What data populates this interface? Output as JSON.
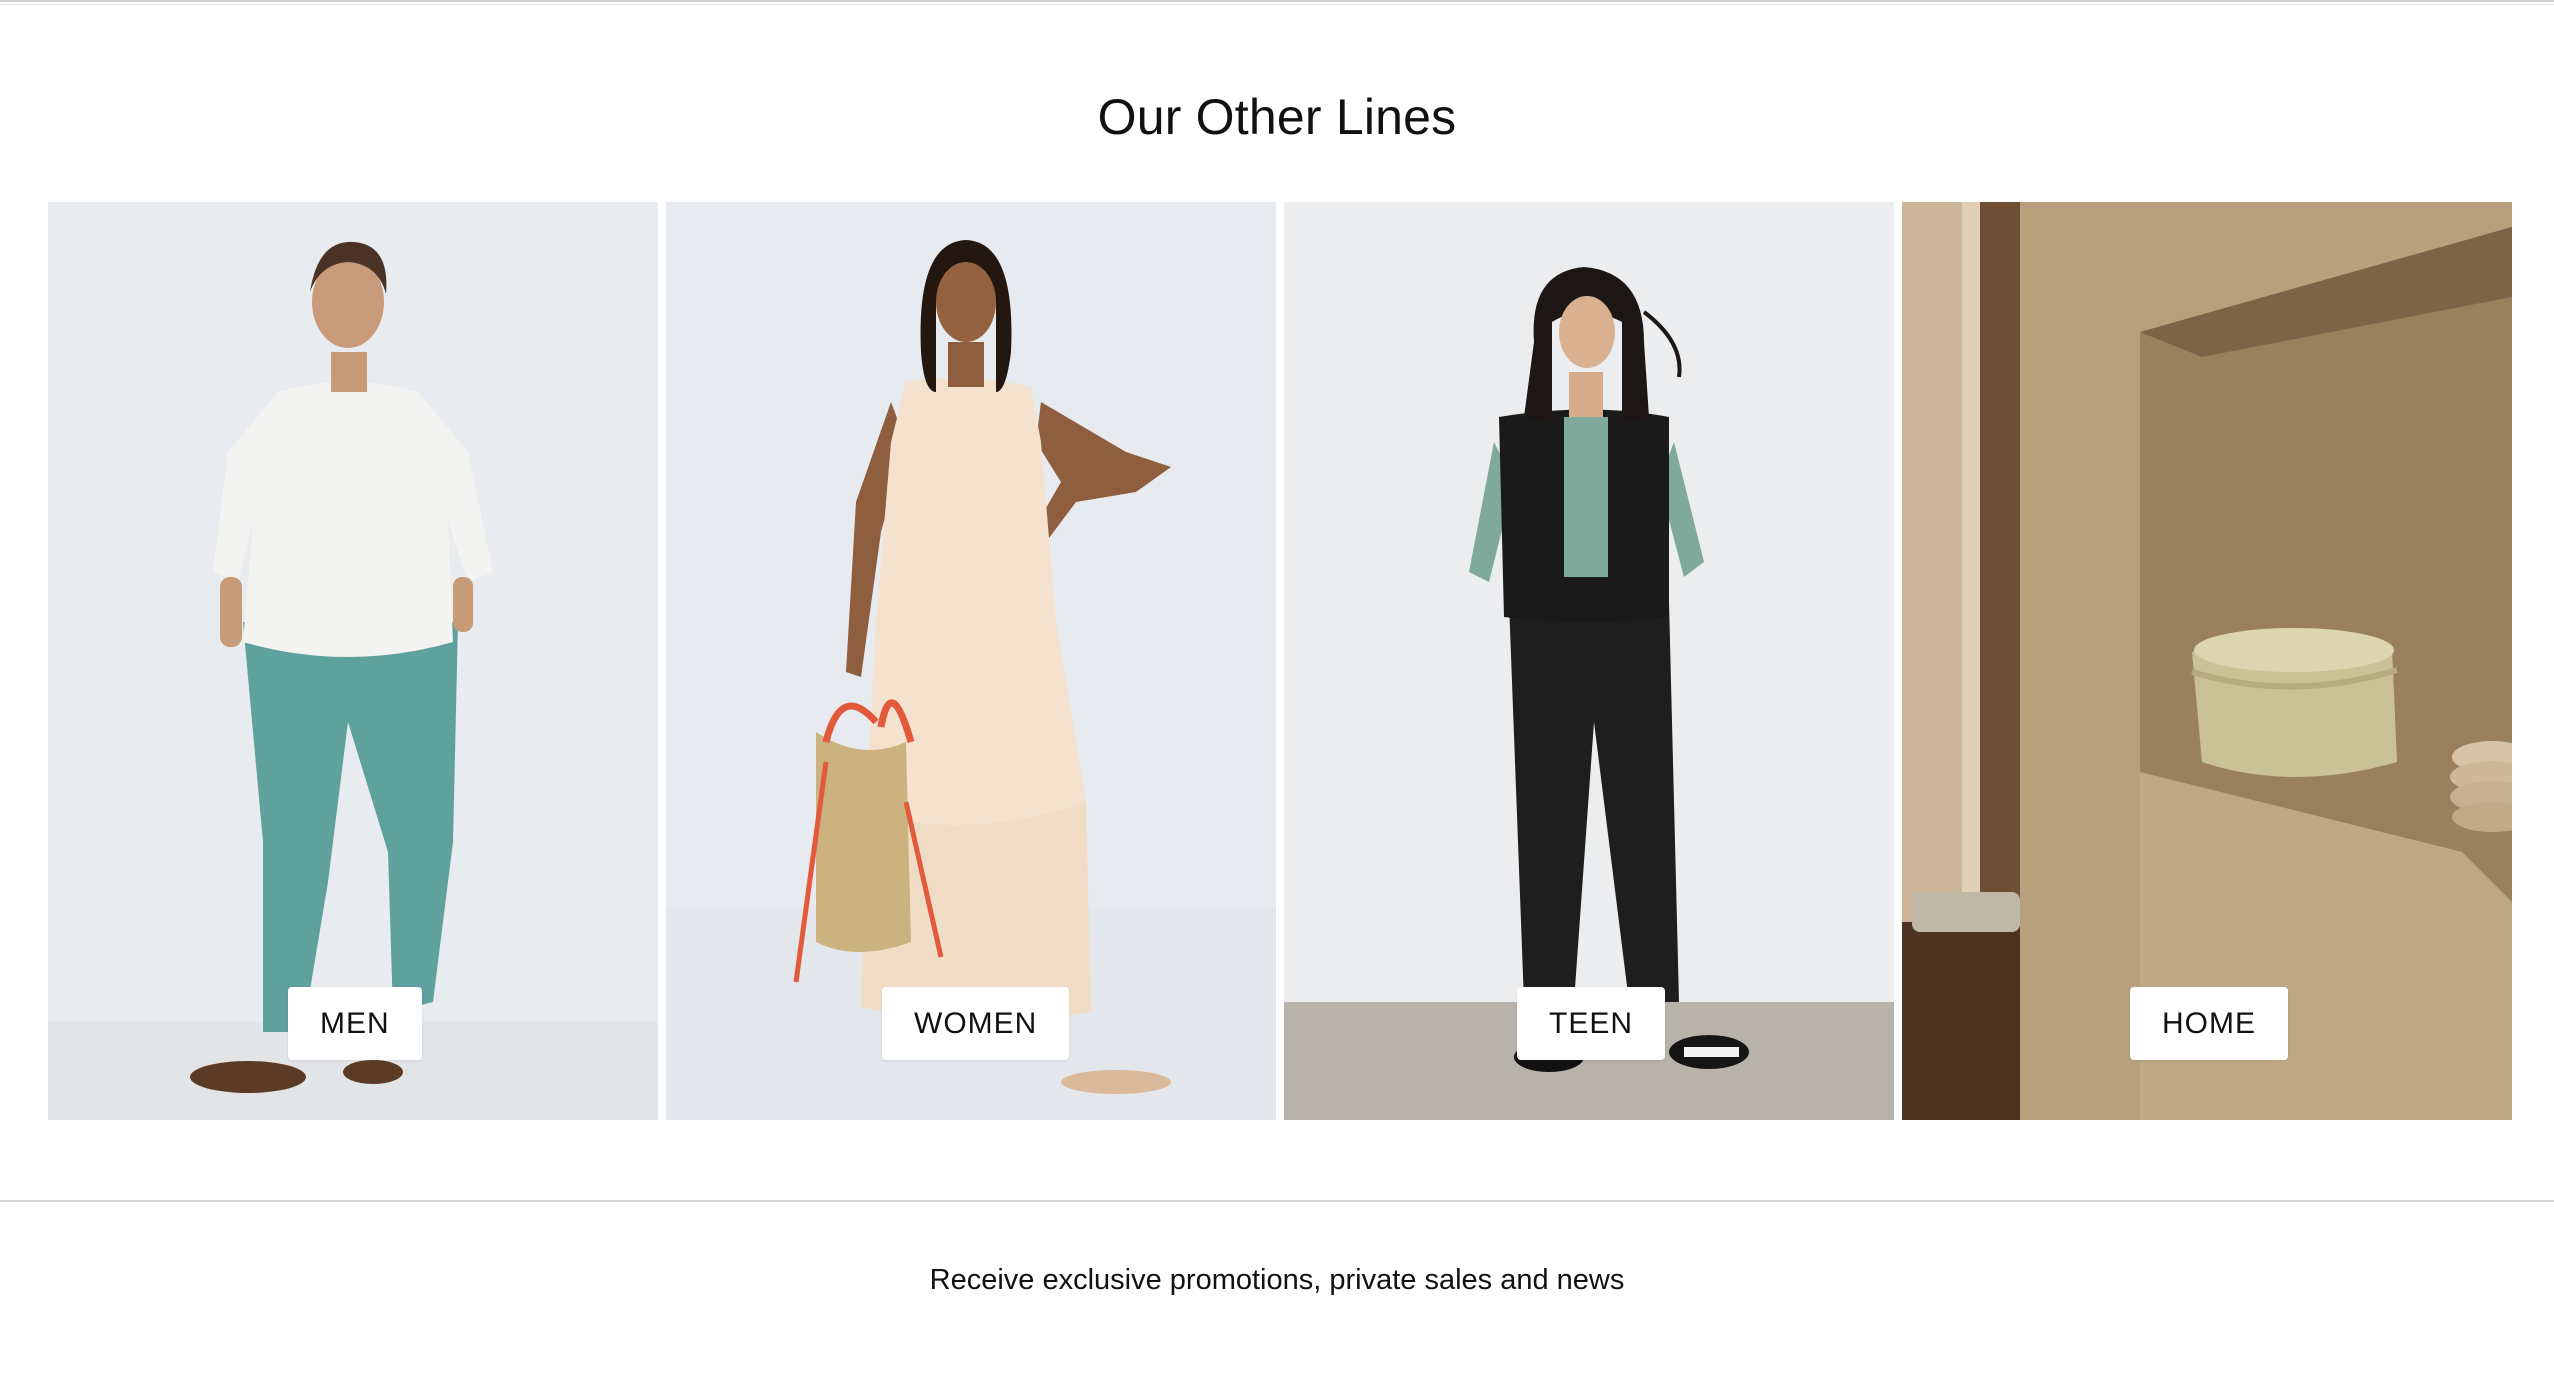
{
  "section": {
    "title": "Our Other Lines"
  },
  "lines": [
    {
      "label": "MEN",
      "image": "man-white-shirt-teal-trousers"
    },
    {
      "label": "WOMEN",
      "image": "woman-cream-dress-straw-bag"
    },
    {
      "label": "TEEN",
      "image": "teen-black-puffer-vest-ripped-jeans"
    },
    {
      "label": "HOME",
      "image": "home-basket-in-wall-niche"
    }
  ],
  "newsletter": {
    "text": "Receive exclusive promotions, private sales and news"
  },
  "colors": {
    "background": "#ffffff",
    "studio_backdrop": "#e8ebee",
    "home_wall": "#b89f7c",
    "button_bg": "#ffffff",
    "text": "#111111"
  }
}
